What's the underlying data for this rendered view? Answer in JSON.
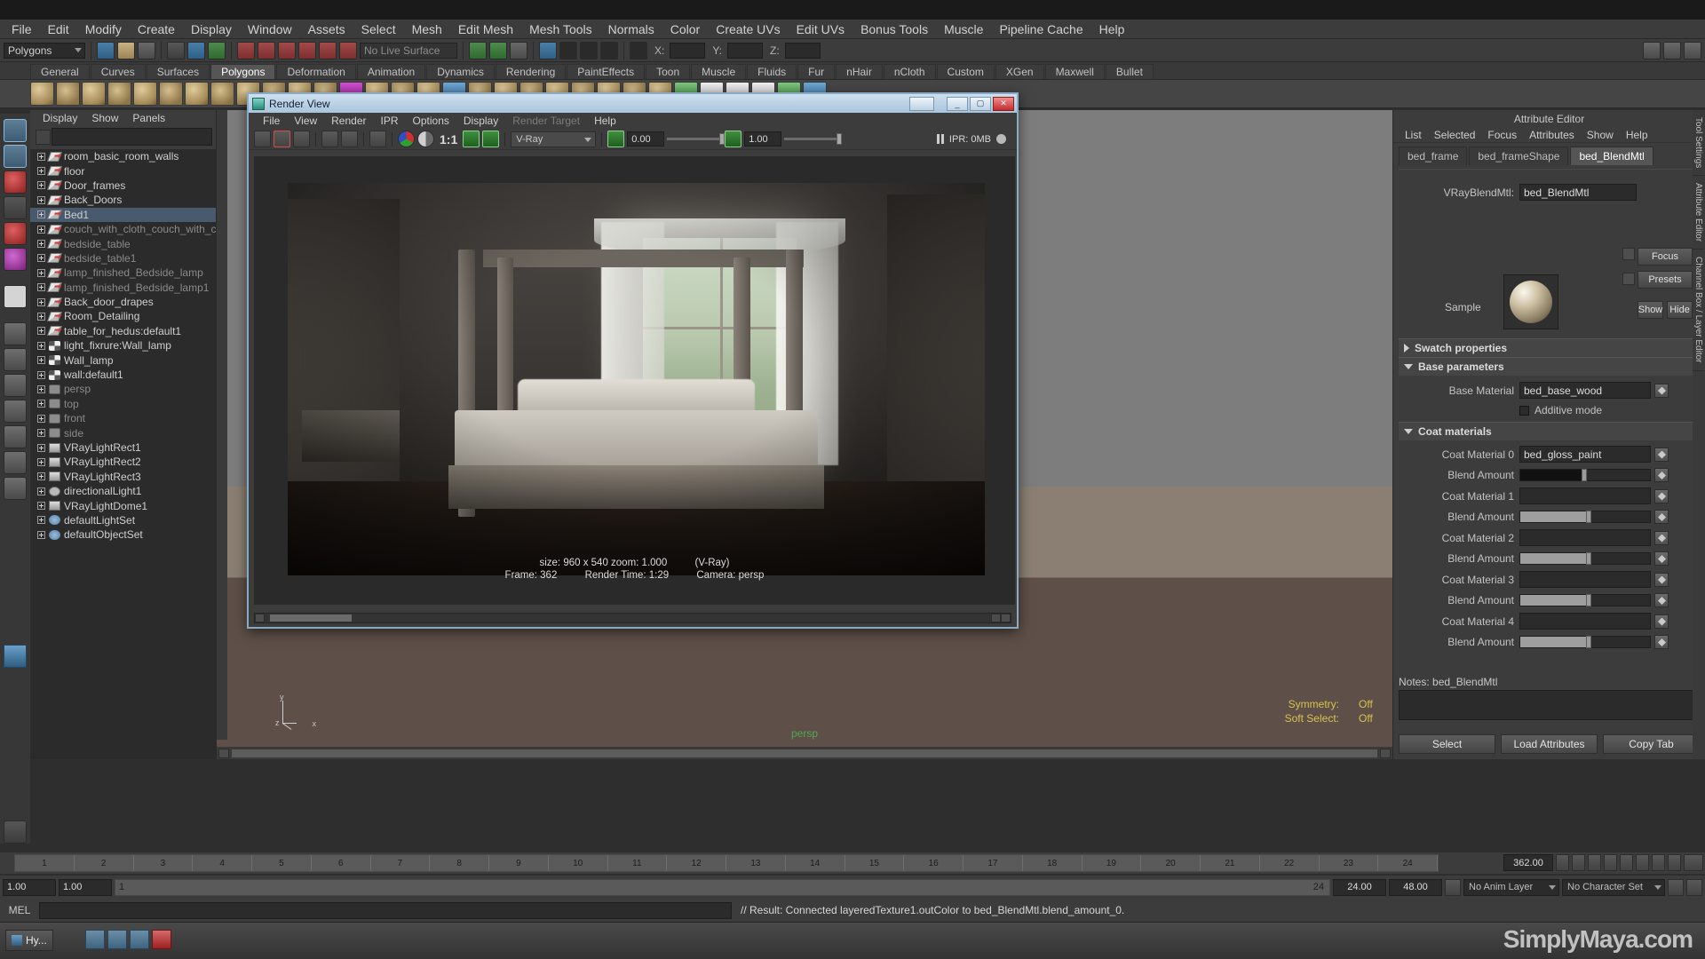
{
  "menubar": {
    "items": [
      "File",
      "Edit",
      "Modify",
      "Create",
      "Display",
      "Window",
      "Assets",
      "Select",
      "Mesh",
      "Edit Mesh",
      "Mesh Tools",
      "Normals",
      "Color",
      "Create UVs",
      "Edit UVs",
      "Bonus Tools",
      "Muscle",
      "Pipeline Cache",
      "Help"
    ]
  },
  "statusline": {
    "mode": "Polygons",
    "live_surface": "No Live Surface",
    "x_label": "X:",
    "y_label": "Y:",
    "z_label": "Z:",
    "x_value": "",
    "y_value": "",
    "z_value": ""
  },
  "shelf": {
    "tabs": [
      "General",
      "Curves",
      "Surfaces",
      "Polygons",
      "Deformation",
      "Animation",
      "Dynamics",
      "Rendering",
      "PaintEffects",
      "Toon",
      "Muscle",
      "Fluids",
      "Fur",
      "nHair",
      "nCloth",
      "Custom",
      "XGen",
      "Maxwell",
      "Bullet"
    ],
    "active_tab": "Polygons"
  },
  "outliner": {
    "menu": [
      "Display",
      "Show",
      "Panels"
    ],
    "search_value": "",
    "items": [
      {
        "label": "room_basic_room_walls",
        "icon": "mesh-icon",
        "dim": false,
        "selected": false
      },
      {
        "label": "floor",
        "icon": "mesh-icon",
        "dim": false,
        "selected": false
      },
      {
        "label": "Door_frames",
        "icon": "mesh-icon",
        "dim": false,
        "selected": false
      },
      {
        "label": "Back_Doors",
        "icon": "mesh-icon",
        "dim": false,
        "selected": false
      },
      {
        "label": "Bed1",
        "icon": "mesh-icon",
        "dim": false,
        "selected": true
      },
      {
        "label": "couch_with_cloth_couch_with_cloth",
        "icon": "mesh-icon",
        "dim": true,
        "selected": false
      },
      {
        "label": "bedside_table",
        "icon": "mesh-icon",
        "dim": true,
        "selected": false
      },
      {
        "label": "bedside_table1",
        "icon": "mesh-icon",
        "dim": true,
        "selected": false
      },
      {
        "label": "lamp_finished_Bedside_lamp",
        "icon": "mesh-icon",
        "dim": true,
        "selected": false
      },
      {
        "label": "lamp_finished_Bedside_lamp1",
        "icon": "mesh-icon",
        "dim": true,
        "selected": false
      },
      {
        "label": "Back_door_drapes",
        "icon": "mesh-icon",
        "dim": false,
        "selected": false
      },
      {
        "label": "Room_Detailing",
        "icon": "mesh-icon",
        "dim": false,
        "selected": false
      },
      {
        "label": "table_for_hedus:default1",
        "icon": "mesh-icon",
        "dim": false,
        "selected": false
      },
      {
        "label": "light_fixrure:Wall_lamp",
        "icon": "group-icon",
        "dim": false,
        "selected": false
      },
      {
        "label": "Wall_lamp",
        "icon": "group-icon",
        "dim": false,
        "selected": false
      },
      {
        "label": "wall:default1",
        "icon": "group-icon",
        "dim": false,
        "selected": false
      },
      {
        "label": "persp",
        "icon": "camera-icon",
        "dim": true,
        "selected": false
      },
      {
        "label": "top",
        "icon": "camera-icon",
        "dim": true,
        "selected": false
      },
      {
        "label": "front",
        "icon": "camera-icon",
        "dim": true,
        "selected": false
      },
      {
        "label": "side",
        "icon": "camera-icon",
        "dim": true,
        "selected": false
      },
      {
        "label": "VRayLightRect1",
        "icon": "vray-light-icon",
        "dim": false,
        "selected": false
      },
      {
        "label": "VRayLightRect2",
        "icon": "vray-light-icon",
        "dim": false,
        "selected": false
      },
      {
        "label": "VRayLightRect3",
        "icon": "vray-light-icon",
        "dim": false,
        "selected": false
      },
      {
        "label": "directionalLight1",
        "icon": "directional-light-icon",
        "dim": false,
        "selected": false
      },
      {
        "label": "VRayLightDome1",
        "icon": "vray-light-icon",
        "dim": false,
        "selected": false
      },
      {
        "label": "defaultLightSet",
        "icon": "set-icon",
        "dim": false,
        "selected": false
      },
      {
        "label": "defaultObjectSet",
        "icon": "set-icon",
        "dim": false,
        "selected": false
      }
    ]
  },
  "viewport": {
    "camera_label": "persp",
    "axis_x": "x",
    "axis_y": "y",
    "axis_z": "z",
    "symmetry_label": "Symmetry:",
    "symmetry_value": "Off",
    "soft_select_label": "Soft Select:",
    "soft_select_value": "Off",
    "heads_up_color": "#d8c24e"
  },
  "render_view": {
    "title": "Render View",
    "menu": [
      "File",
      "View",
      "Render",
      "IPR",
      "Options",
      "Display",
      "Render Target",
      "Help"
    ],
    "disabled_menu": "Render Target",
    "renderer": "V-Ray",
    "exposure_value": "0.00",
    "gamma_value": "1.00",
    "ratio_label": "1:1",
    "ipr_label": "IPR: 0MB",
    "status_size": "size: 960 x 540 zoom: 1.000",
    "status_renderer": "(V-Ray)",
    "status_frame": "Frame: 362",
    "status_time": "Render Time: 1:29",
    "status_camera": "Camera: persp",
    "titlebar_buttons": [
      "minimize",
      "restore",
      "close"
    ]
  },
  "attribute_editor": {
    "title": "Attribute Editor",
    "menu": [
      "List",
      "Selected",
      "Focus",
      "Attributes",
      "Show",
      "Help"
    ],
    "tabs": [
      "bed_frame",
      "bed_frameShape",
      "bed_BlendMtl"
    ],
    "active_tab": "bed_BlendMtl",
    "node_type_label": "VRayBlendMtl:",
    "node_name": "bed_BlendMtl",
    "side_buttons": [
      "Focus",
      "Presets"
    ],
    "show_hide_buttons": [
      "Show",
      "Hide"
    ],
    "sample_label": "Sample",
    "sections": [
      {
        "name": "Swatch properties",
        "expanded": false
      },
      {
        "name": "Base parameters",
        "expanded": true
      },
      {
        "name": "Coat materials",
        "expanded": true
      }
    ],
    "base_material_label": "Base Material",
    "base_material_value": "bed_base_wood",
    "additive_mode_label": "Additive mode",
    "additive_mode_checked": false,
    "coat_rows": [
      {
        "material_label": "Coat Material 0",
        "material_value": "bed_gloss_paint",
        "blend_label": "Blend Amount",
        "blend_fill": "#111111",
        "blend_pct": 48
      },
      {
        "material_label": "Coat Material 1",
        "material_value": "",
        "blend_label": "Blend Amount",
        "blend_fill": "#9e9e9e",
        "blend_pct": 52
      },
      {
        "material_label": "Coat Material 2",
        "material_value": "",
        "blend_label": "Blend Amount",
        "blend_fill": "#9e9e9e",
        "blend_pct": 52
      },
      {
        "material_label": "Coat Material 3",
        "material_value": "",
        "blend_label": "Blend Amount",
        "blend_fill": "#9e9e9e",
        "blend_pct": 52
      },
      {
        "material_label": "Coat Material 4",
        "material_value": "",
        "blend_label": "Blend Amount",
        "blend_fill": "#9e9e9e",
        "blend_pct": 52
      }
    ],
    "notes_label": "Notes: bed_BlendMtl",
    "notes_value": "",
    "footer_buttons": [
      "Select",
      "Load Attributes",
      "Copy Tab"
    ]
  },
  "right_tabs": [
    "Tool Settings",
    "Attribute Editor",
    "Channel Box / Layer Editor"
  ],
  "timeline": {
    "ticks": [
      "1",
      "2",
      "3",
      "4",
      "5",
      "6",
      "7",
      "8",
      "9",
      "10",
      "11",
      "12",
      "13",
      "14",
      "15",
      "16",
      "17",
      "18",
      "19",
      "20",
      "21",
      "22",
      "23",
      "24"
    ],
    "current_frame": "362.00"
  },
  "range": {
    "start": "1.00",
    "end": "1.00",
    "playback_start": "1",
    "playback_end": "24",
    "range_end": "24.00",
    "anim_end": "48.00",
    "anim_layer": "No Anim Layer",
    "character_set": "No Character Set"
  },
  "command_line": {
    "label": "MEL",
    "input_value": "",
    "result": "// Result: Connected layeredTexture1.outColor to bed_BlendMtl.blend_amount_0."
  },
  "taskbar": {
    "item_label": "Hy...",
    "watermark": "SimplyMaya.com"
  }
}
